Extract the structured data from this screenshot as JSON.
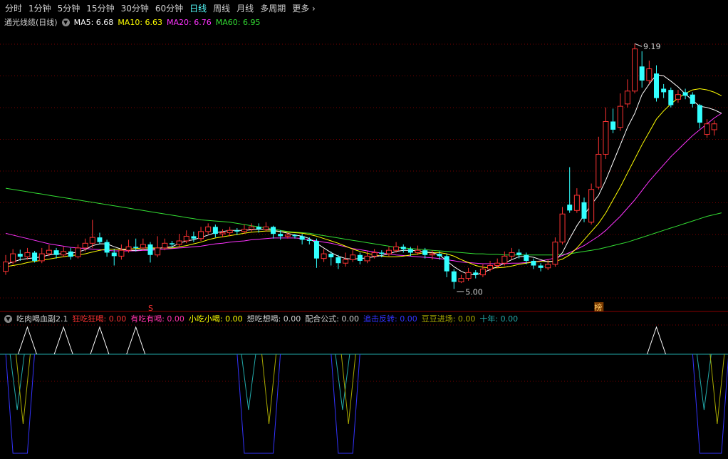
{
  "toolbar": {
    "tabs": [
      "分时",
      "1分钟",
      "5分钟",
      "15分钟",
      "30分钟",
      "60分钟",
      "日线",
      "周线",
      "月线",
      "多周期",
      "更多"
    ],
    "active_index": 6
  },
  "main_legend": {
    "title": "通光线缆(日线)",
    "items": [
      {
        "label": "MA5: 6.68",
        "color": "#ffffff"
      },
      {
        "label": "MA10: 6.63",
        "color": "#ffff00"
      },
      {
        "label": "MA20: 6.76",
        "color": "#ff33ff"
      },
      {
        "label": "MA60: 6.95",
        "color": "#33dd33"
      }
    ]
  },
  "sub_legend": {
    "title": "吃肉喝血副2.1",
    "items": [
      {
        "label": "狂吃狂喝: 0.00",
        "color": "#ff3333"
      },
      {
        "label": "有吃有喝: 0.00",
        "color": "#ff33aa"
      },
      {
        "label": "小吃小喝: 0.00",
        "color": "#ffff00"
      },
      {
        "label": "想吃想喝: 0.00",
        "color": "#d0d0d0"
      },
      {
        "label": "配合公式: 0.00",
        "color": "#d0d0d0"
      },
      {
        "label": "追击反转: 0.00",
        "color": "#3333ff"
      },
      {
        "label": "豆豆进场: 0.00",
        "color": "#aaaa00"
      },
      {
        "label": "十年: 0.00",
        "color": "#22aaaa"
      }
    ]
  },
  "annotations": {
    "high": "9.19",
    "low": "5.00",
    "buy_marker": "S",
    "tag": "榜"
  },
  "colors": {
    "up": "#ff3333",
    "down": "#33ffff",
    "grid": "#7a0000"
  },
  "chart_data": {
    "type": "candlestick",
    "y_range_approx": [
      4.7,
      9.4
    ],
    "candles": [
      [
        5.3,
        5.46,
        5.58,
        5.24
      ],
      [
        5.46,
        5.6,
        5.68,
        5.42
      ],
      [
        5.6,
        5.55,
        5.67,
        5.48
      ],
      [
        5.55,
        5.62,
        5.7,
        5.5
      ],
      [
        5.62,
        5.48,
        5.65,
        5.45
      ],
      [
        5.48,
        5.6,
        5.7,
        5.44
      ],
      [
        5.6,
        5.66,
        5.75,
        5.56
      ],
      [
        5.66,
        5.58,
        5.7,
        5.52
      ],
      [
        5.58,
        5.64,
        5.72,
        5.54
      ],
      [
        5.64,
        5.55,
        5.7,
        5.5
      ],
      [
        5.55,
        5.7,
        5.76,
        5.52
      ],
      [
        5.7,
        5.78,
        5.86,
        5.64
      ],
      [
        5.78,
        5.88,
        6.18,
        5.7
      ],
      [
        5.88,
        5.8,
        5.96,
        5.76
      ],
      [
        5.8,
        5.62,
        5.84,
        5.55
      ],
      [
        5.62,
        5.56,
        5.68,
        5.4
      ],
      [
        5.56,
        5.66,
        5.76,
        5.5
      ],
      [
        5.66,
        5.72,
        5.84,
        5.62
      ],
      [
        5.72,
        5.7,
        5.86,
        5.64
      ],
      [
        5.7,
        5.76,
        5.86,
        5.66
      ],
      [
        5.76,
        5.58,
        5.8,
        5.45
      ],
      [
        5.58,
        5.7,
        5.9,
        5.54
      ],
      [
        5.7,
        5.78,
        5.86,
        5.66
      ],
      [
        5.78,
        5.76,
        5.82,
        5.7
      ],
      [
        5.76,
        5.82,
        5.94,
        5.72
      ],
      [
        5.82,
        5.9,
        6.0,
        5.78
      ],
      [
        5.9,
        5.86,
        5.98,
        5.8
      ],
      [
        5.86,
        5.98,
        6.06,
        5.82
      ],
      [
        5.98,
        6.06,
        6.12,
        5.94
      ],
      [
        6.06,
        5.94,
        6.1,
        5.88
      ],
      [
        5.94,
        5.96,
        6.02,
        5.88
      ],
      [
        5.96,
        6.0,
        6.06,
        5.9
      ],
      [
        6.0,
        5.98,
        6.04,
        5.92
      ],
      [
        5.98,
        6.02,
        6.1,
        5.94
      ],
      [
        6.02,
        6.06,
        6.12,
        5.98
      ],
      [
        6.06,
        6.02,
        6.12,
        5.96
      ],
      [
        6.02,
        6.06,
        6.14,
        5.98
      ],
      [
        6.06,
        5.94,
        6.08,
        5.86
      ],
      [
        5.94,
        5.9,
        6.0,
        5.84
      ],
      [
        5.9,
        5.92,
        5.96,
        5.86
      ],
      [
        5.92,
        5.9,
        5.94,
        5.86
      ],
      [
        5.9,
        5.84,
        5.94,
        5.76
      ],
      [
        5.84,
        5.82,
        5.88,
        5.76
      ],
      [
        5.82,
        5.52,
        5.86,
        5.36
      ],
      [
        5.52,
        5.6,
        5.68,
        5.46
      ],
      [
        5.6,
        5.54,
        5.64,
        5.4
      ],
      [
        5.54,
        5.44,
        5.58,
        5.34
      ],
      [
        5.44,
        5.5,
        5.62,
        5.38
      ],
      [
        5.5,
        5.58,
        5.66,
        5.46
      ],
      [
        5.58,
        5.48,
        5.62,
        5.42
      ],
      [
        5.48,
        5.56,
        5.64,
        5.44
      ],
      [
        5.56,
        5.62,
        5.68,
        5.52
      ],
      [
        5.62,
        5.6,
        5.66,
        5.54
      ],
      [
        5.6,
        5.66,
        5.72,
        5.56
      ],
      [
        5.66,
        5.72,
        5.8,
        5.62
      ],
      [
        5.72,
        5.68,
        5.76,
        5.62
      ],
      [
        5.68,
        5.62,
        5.72,
        5.56
      ],
      [
        5.62,
        5.66,
        5.74,
        5.58
      ],
      [
        5.66,
        5.58,
        5.7,
        5.52
      ],
      [
        5.58,
        5.6,
        5.66,
        5.5
      ],
      [
        5.6,
        5.56,
        5.64,
        5.5
      ],
      [
        5.56,
        5.3,
        5.6,
        5.2
      ],
      [
        5.3,
        5.12,
        5.34,
        5.0
      ],
      [
        5.12,
        5.18,
        5.24,
        5.1
      ],
      [
        5.18,
        5.28,
        5.36,
        5.14
      ],
      [
        5.28,
        5.24,
        5.32,
        5.18
      ],
      [
        5.24,
        5.34,
        5.42,
        5.2
      ],
      [
        5.34,
        5.4,
        5.48,
        5.3
      ],
      [
        5.4,
        5.44,
        5.52,
        5.36
      ],
      [
        5.44,
        5.56,
        5.64,
        5.4
      ],
      [
        5.56,
        5.62,
        5.7,
        5.5
      ],
      [
        5.62,
        5.58,
        5.68,
        5.52
      ],
      [
        5.58,
        5.48,
        5.62,
        5.42
      ],
      [
        5.48,
        5.4,
        5.52,
        5.34
      ],
      [
        5.4,
        5.36,
        5.44,
        5.3
      ],
      [
        5.36,
        5.42,
        5.5,
        5.32
      ],
      [
        5.42,
        5.8,
        5.88,
        5.38
      ],
      [
        5.8,
        6.28,
        6.4,
        5.76
      ],
      [
        6.44,
        6.34,
        7.08,
        6.3
      ],
      [
        6.34,
        6.6,
        6.72,
        6.3
      ],
      [
        6.48,
        6.2,
        6.56,
        6.14
      ],
      [
        6.14,
        6.7,
        6.8,
        6.1
      ],
      [
        6.74,
        7.3,
        7.6,
        6.7
      ],
      [
        7.3,
        7.86,
        8.1,
        7.22
      ],
      [
        7.86,
        7.72,
        8.08,
        7.66
      ],
      [
        7.76,
        8.12,
        8.34,
        7.7
      ],
      [
        8.16,
        8.38,
        8.58,
        8.1
      ],
      [
        8.38,
        9.1,
        9.19,
        8.34
      ],
      [
        8.8,
        8.56,
        9.06,
        8.44
      ],
      [
        8.56,
        8.76,
        8.9,
        8.5
      ],
      [
        8.68,
        8.26,
        8.82,
        8.2
      ],
      [
        8.42,
        8.36,
        8.5,
        8.26
      ],
      [
        8.4,
        8.14,
        8.44,
        8.1
      ],
      [
        8.24,
        8.32,
        8.4,
        8.18
      ],
      [
        8.36,
        8.3,
        8.42,
        8.24
      ],
      [
        8.32,
        8.16,
        8.36,
        8.1
      ],
      [
        8.14,
        7.84,
        8.16,
        7.74
      ],
      [
        7.64,
        7.82,
        7.9,
        7.58
      ],
      [
        7.72,
        7.82,
        7.88,
        7.62
      ]
    ],
    "ma5": [
      5.42,
      5.46,
      5.5,
      5.52,
      5.53,
      5.55,
      5.58,
      5.6,
      5.6,
      5.61,
      5.63,
      5.67,
      5.74,
      5.77,
      5.77,
      5.72,
      5.68,
      5.66,
      5.66,
      5.67,
      5.68,
      5.69,
      5.71,
      5.72,
      5.78,
      5.82,
      5.84,
      5.88,
      5.92,
      5.96,
      5.98,
      6.0,
      6.0,
      6.0,
      6.01,
      6.02,
      6.02,
      6.0,
      5.98,
      5.95,
      5.92,
      5.9,
      5.86,
      5.78,
      5.7,
      5.62,
      5.56,
      5.52,
      5.51,
      5.52,
      5.53,
      5.55,
      5.57,
      5.6,
      5.64,
      5.66,
      5.66,
      5.65,
      5.63,
      5.62,
      5.58,
      5.48,
      5.38,
      5.3,
      5.25,
      5.24,
      5.28,
      5.33,
      5.38,
      5.44,
      5.5,
      5.55,
      5.56,
      5.54,
      5.5,
      5.46,
      5.48,
      5.62,
      5.86,
      6.08,
      6.26,
      6.44,
      6.6,
      6.86,
      7.16,
      7.46,
      7.76,
      8.0,
      8.32,
      8.5,
      8.66,
      8.64,
      8.55,
      8.45,
      8.33,
      8.22,
      8.12,
      8.1,
      8.06,
      8.0
    ],
    "ma10": [
      5.38,
      5.4,
      5.42,
      5.45,
      5.47,
      5.49,
      5.51,
      5.53,
      5.55,
      5.57,
      5.58,
      5.6,
      5.63,
      5.66,
      5.68,
      5.68,
      5.68,
      5.68,
      5.69,
      5.7,
      5.7,
      5.7,
      5.7,
      5.7,
      5.72,
      5.74,
      5.77,
      5.8,
      5.84,
      5.87,
      5.89,
      5.91,
      5.93,
      5.95,
      5.97,
      5.98,
      5.99,
      5.99,
      5.98,
      5.97,
      5.96,
      5.95,
      5.93,
      5.9,
      5.86,
      5.82,
      5.78,
      5.73,
      5.68,
      5.64,
      5.61,
      5.58,
      5.56,
      5.55,
      5.55,
      5.56,
      5.58,
      5.6,
      5.62,
      5.62,
      5.62,
      5.6,
      5.56,
      5.5,
      5.45,
      5.4,
      5.37,
      5.36,
      5.36,
      5.37,
      5.39,
      5.42,
      5.44,
      5.46,
      5.47,
      5.47,
      5.47,
      5.51,
      5.58,
      5.7,
      5.84,
      5.98,
      6.12,
      6.3,
      6.52,
      6.74,
      6.98,
      7.22,
      7.46,
      7.68,
      7.9,
      8.04,
      8.16,
      8.26,
      8.34,
      8.4,
      8.42,
      8.4,
      8.36,
      8.3
    ],
    "ma20": [
      5.95,
      5.92,
      5.89,
      5.86,
      5.83,
      5.8,
      5.77,
      5.75,
      5.73,
      5.71,
      5.7,
      5.69,
      5.68,
      5.67,
      5.66,
      5.65,
      5.65,
      5.65,
      5.65,
      5.66,
      5.66,
      5.67,
      5.68,
      5.69,
      5.7,
      5.71,
      5.72,
      5.73,
      5.75,
      5.77,
      5.78,
      5.8,
      5.81,
      5.82,
      5.84,
      5.85,
      5.86,
      5.87,
      5.87,
      5.87,
      5.87,
      5.86,
      5.84,
      5.82,
      5.8,
      5.78,
      5.75,
      5.72,
      5.69,
      5.67,
      5.65,
      5.63,
      5.61,
      5.6,
      5.58,
      5.57,
      5.56,
      5.55,
      5.54,
      5.53,
      5.52,
      5.5,
      5.48,
      5.46,
      5.45,
      5.44,
      5.43,
      5.43,
      5.43,
      5.43,
      5.44,
      5.44,
      5.45,
      5.46,
      5.48,
      5.5,
      5.53,
      5.57,
      5.62,
      5.68,
      5.74,
      5.82,
      5.9,
      6.0,
      6.12,
      6.24,
      6.38,
      6.52,
      6.68,
      6.84,
      6.98,
      7.12,
      7.26,
      7.38,
      7.5,
      7.62,
      7.72,
      7.82,
      7.92,
      8.0
    ],
    "ma60": [
      6.72,
      6.7,
      6.68,
      6.66,
      6.64,
      6.62,
      6.6,
      6.58,
      6.56,
      6.54,
      6.52,
      6.5,
      6.48,
      6.46,
      6.44,
      6.42,
      6.4,
      6.38,
      6.36,
      6.34,
      6.32,
      6.3,
      6.28,
      6.26,
      6.24,
      6.22,
      6.2,
      6.18,
      6.17,
      6.16,
      6.15,
      6.14,
      6.12,
      6.1,
      6.08,
      6.06,
      6.04,
      6.02,
      6.0,
      5.98,
      5.97,
      5.96,
      5.95,
      5.93,
      5.91,
      5.89,
      5.87,
      5.85,
      5.83,
      5.81,
      5.79,
      5.77,
      5.75,
      5.73,
      5.71,
      5.7,
      5.69,
      5.68,
      5.67,
      5.66,
      5.65,
      5.64,
      5.63,
      5.62,
      5.61,
      5.6,
      5.6,
      5.59,
      5.59,
      5.58,
      5.58,
      5.58,
      5.58,
      5.58,
      5.58,
      5.58,
      5.58,
      5.59,
      5.6,
      5.62,
      5.64,
      5.66,
      5.68,
      5.71,
      5.74,
      5.77,
      5.8,
      5.84,
      5.88,
      5.92,
      5.96,
      6.0,
      6.04,
      6.08,
      6.12,
      6.16,
      6.2,
      6.24,
      6.27,
      6.3
    ],
    "sub_indicator": {
      "baseline_level": 1,
      "spike_indices": [
        3,
        8,
        13,
        18,
        90
      ],
      "drop_events": [
        {
          "start": 1,
          "end": 3,
          "level": 0
        },
        {
          "start": 33,
          "end": 37,
          "level": 0
        },
        {
          "start": 46,
          "end": 48,
          "level": 0
        },
        {
          "start": 96,
          "end": 99,
          "level": 0
        }
      ]
    }
  }
}
